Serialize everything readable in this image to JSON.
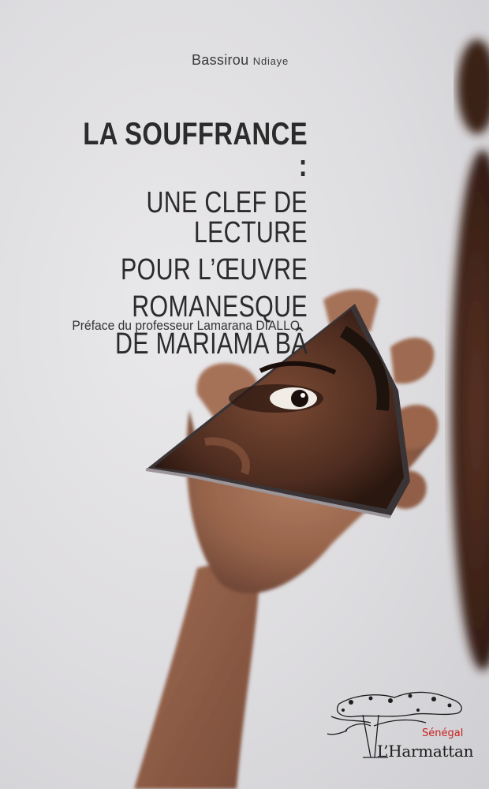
{
  "cover": {
    "author_given": "Bassirou",
    "author_family": "Ndiaye",
    "title_main": "LA SOUFFRANCE :",
    "title_lines": [
      "UNE CLEF DE LECTURE",
      "POUR L’ŒUVRE",
      "ROMANESQUE",
      "DE MARIAMA BÂ"
    ],
    "preface": "Préface du professeur Lamarana DIALLO",
    "publisher_region": "Sénégal",
    "publisher_name": "L’Harmattan"
  },
  "icons": {
    "publisher_logo": "baobab-tree-icon",
    "cover_art": "hand-holding-mirror-shard-photo"
  },
  "colors": {
    "background": "#e2e1e4",
    "text": "#2b2b2b",
    "publisher_region": "#c81f1f"
  }
}
